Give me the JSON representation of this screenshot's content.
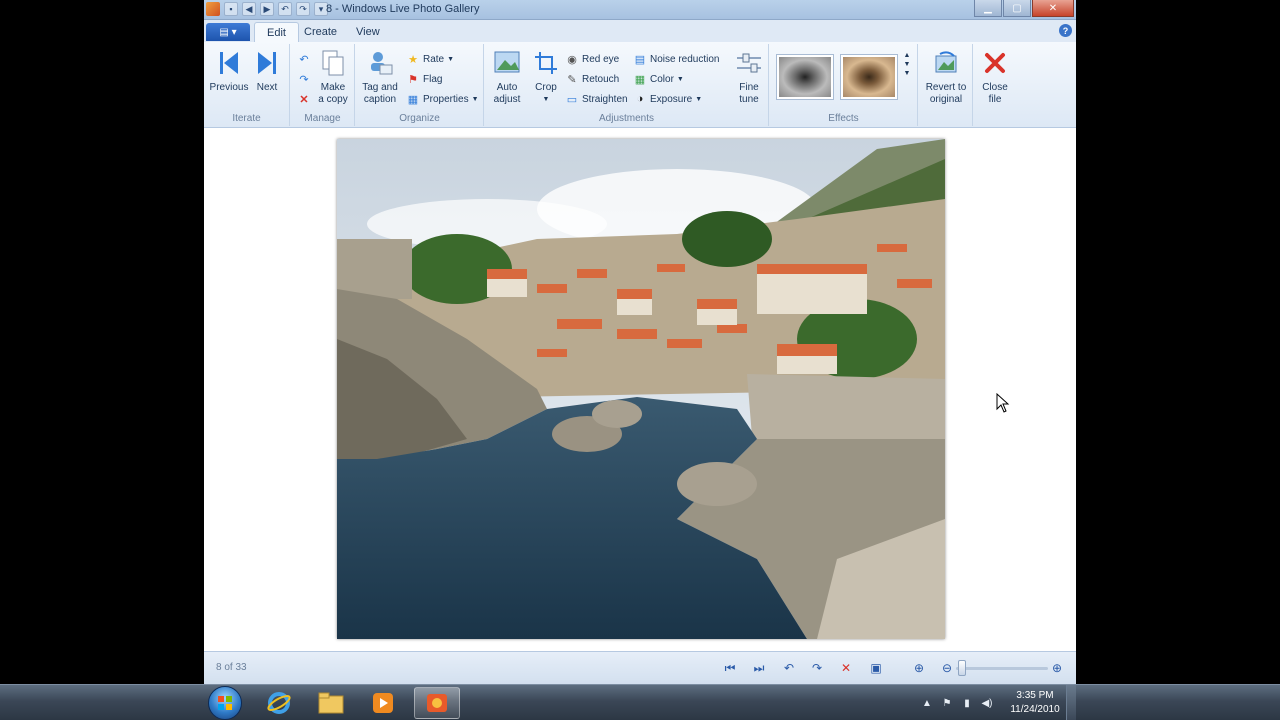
{
  "window": {
    "title": "8 - Windows Live Photo Gallery"
  },
  "tabs": [
    {
      "label": "Edit",
      "active": true
    },
    {
      "label": "Create",
      "active": false
    },
    {
      "label": "View",
      "active": false
    }
  ],
  "ribbon": {
    "iterate": {
      "label": "Iterate",
      "previous": "Previous",
      "next": "Next"
    },
    "manage": {
      "label": "Manage",
      "make_copy_line1": "Make",
      "make_copy_line2": "a copy"
    },
    "organize": {
      "label": "Organize",
      "tag_line1": "Tag and",
      "tag_line2": "caption",
      "rate": "Rate",
      "flag": "Flag",
      "properties": "Properties"
    },
    "adjustments": {
      "label": "Adjustments",
      "auto_line1": "Auto",
      "auto_line2": "adjust",
      "crop": "Crop",
      "red_eye": "Red eye",
      "retouch": "Retouch",
      "straighten": "Straighten",
      "noise_reduction": "Noise reduction",
      "color": "Color",
      "exposure": "Exposure",
      "fine_line1": "Fine",
      "fine_line2": "tune"
    },
    "effects": {
      "label": "Effects"
    },
    "revert_line1": "Revert to",
    "revert_line2": "original",
    "close_line1": "Close",
    "close_line2": "file"
  },
  "status": {
    "photo_count": "8 of 33"
  },
  "taskbar": {
    "time": "3:35 PM",
    "date": "11/24/2010"
  },
  "colors": {
    "accent": "#1d54ad",
    "close_red": "#d9332a"
  }
}
